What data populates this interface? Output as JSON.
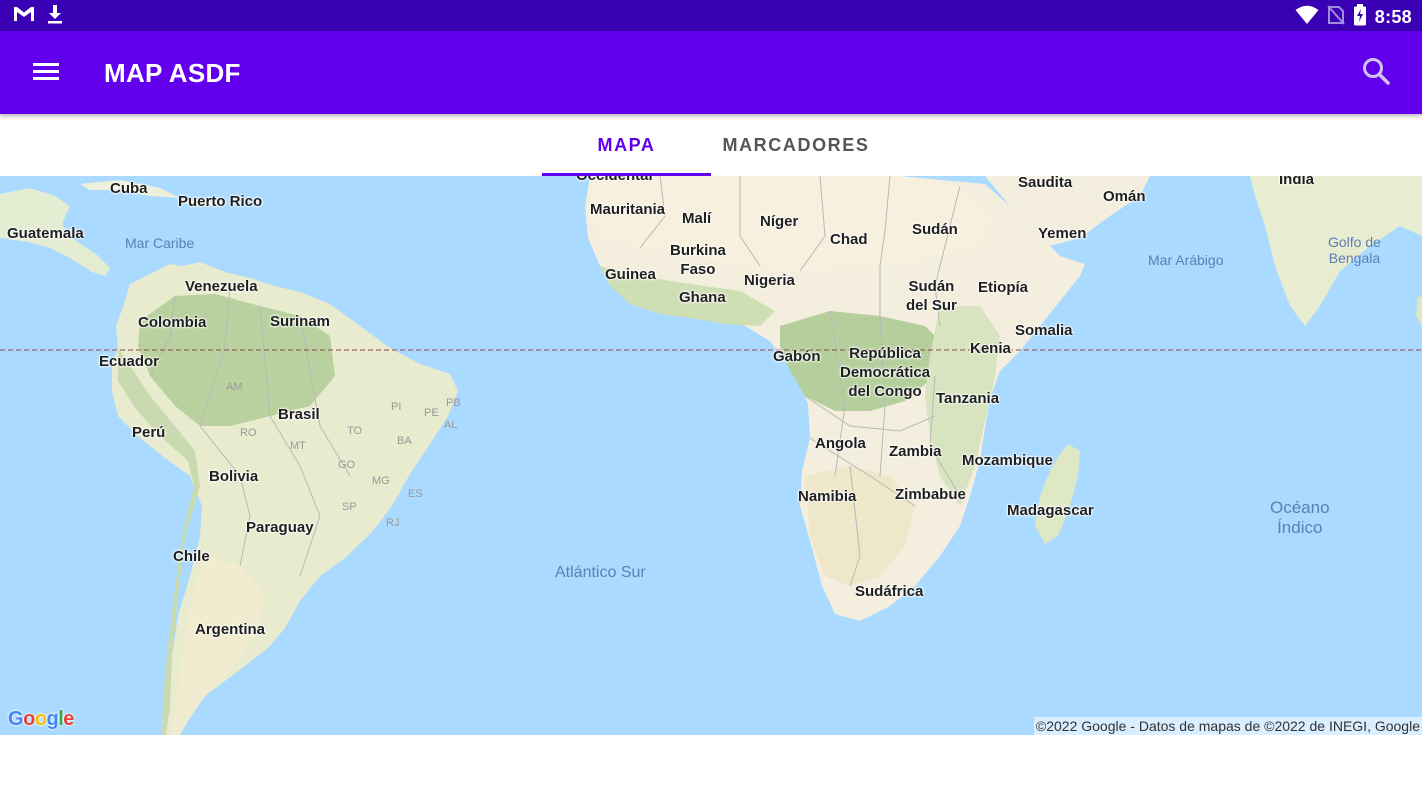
{
  "status_bar": {
    "time": "8:58",
    "left_icons": [
      "gmail-icon",
      "download-icon"
    ],
    "right_icons": [
      "wifi-icon",
      "no-sim-icon",
      "battery-charging-icon"
    ]
  },
  "app_bar": {
    "title": "MAP ASDF",
    "background": "#6200ee"
  },
  "tabs": [
    {
      "label": "MAPA",
      "active": true
    },
    {
      "label": "MARCADORES",
      "active": false
    }
  ],
  "map": {
    "countries": {
      "cuba": "Cuba",
      "puerto_rico": "Puerto Rico",
      "guatemala": "Guatemala",
      "venezuela": "Venezuela",
      "colombia": "Colombia",
      "surinam": "Surinam",
      "ecuador": "Ecuador",
      "brasil": "Brasil",
      "peru": "Perú",
      "bolivia": "Bolivia",
      "paraguay": "Paraguay",
      "chile": "Chile",
      "argentina": "Argentina",
      "mauritania": "Mauritania",
      "mali": "Malí",
      "niger": "Níger",
      "chad": "Chad",
      "sudan": "Sudán",
      "saudita": "Saudita",
      "oman": "Omán",
      "india": "India",
      "yemen": "Yemen",
      "burkina": "Burkina",
      "faso": "Faso",
      "guinea": "Guinea",
      "ghana": "Ghana",
      "nigeria": "Nigeria",
      "sudan_del_sur_1": "Sudán",
      "sudan_del_sur_2": "del Sur",
      "etiopia": "Etiopía",
      "somalia": "Somalia",
      "kenia": "Kenia",
      "gabon": "Gabón",
      "rdc_1": "República",
      "rdc_2": "Democrática",
      "rdc_3": "del Congo",
      "tanzania": "Tanzania",
      "angola": "Angola",
      "zambia": "Zambia",
      "mozambique": "Mozambique",
      "namibia": "Namibia",
      "zimbabue": "Zimbabue",
      "madagascar": "Madagascar",
      "sudafrica": "Sudáfrica",
      "occidental_partial": "Occidental"
    },
    "waters": {
      "mar_caribe": "Mar Caribe",
      "mar_arabigo": "Mar Arábigo",
      "golfo_1": "Golfo de",
      "golfo_2": "Bengala",
      "atlantico_sur": "Atlántico Sur",
      "oceano_1": "Océano",
      "oceano_2": "Índico"
    },
    "states": [
      "AM",
      "PI",
      "PE",
      "PB",
      "AL",
      "RO",
      "MT",
      "TO",
      "BA",
      "GO",
      "MG",
      "ES",
      "SP",
      "RJ"
    ],
    "google_logo": "Google",
    "attribution": "©2022 Google - Datos de mapas de ©2022 de INEGI, Google"
  }
}
